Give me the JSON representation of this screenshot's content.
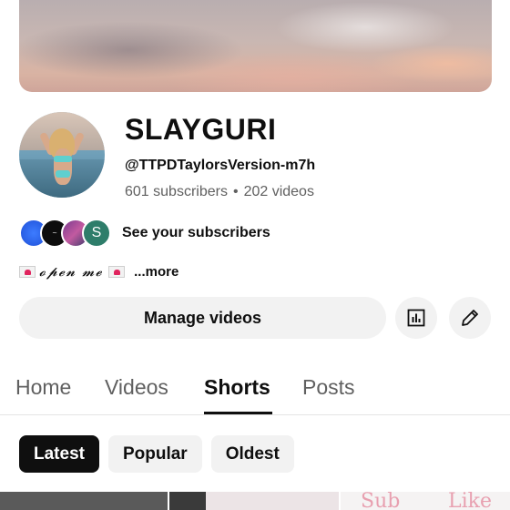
{
  "channel": {
    "name": "SLAYGURI",
    "handle": "@TTPDTaylorsVersion-m7h",
    "subscribers": "601 subscribers",
    "separator": "•",
    "videos": "202 videos"
  },
  "subscribers_row": {
    "label": "See your subscribers",
    "avatars": [
      "",
      "",
      "",
      "S"
    ]
  },
  "bio": {
    "text": "𝓸𝓹𝓮𝓷 𝓶𝓮",
    "more": "...more"
  },
  "actions": {
    "manage_videos": "Manage videos",
    "analytics_icon": "bar-chart-icon",
    "edit_icon": "pencil-icon"
  },
  "tabs": [
    {
      "label": "Home",
      "active": false
    },
    {
      "label": "Videos",
      "active": false
    },
    {
      "label": "Shorts",
      "active": true
    },
    {
      "label": "Posts",
      "active": false
    }
  ],
  "chips": [
    {
      "label": "Latest",
      "selected": true
    },
    {
      "label": "Popular",
      "selected": false
    },
    {
      "label": "Oldest",
      "selected": false
    }
  ],
  "thumbnails": {
    "t3_text_left": "Sub",
    "t3_text_right": "Like"
  },
  "colors": {
    "text_primary": "#0f0f0f",
    "text_secondary": "#606060",
    "chip_bg": "#f2f2f2"
  }
}
